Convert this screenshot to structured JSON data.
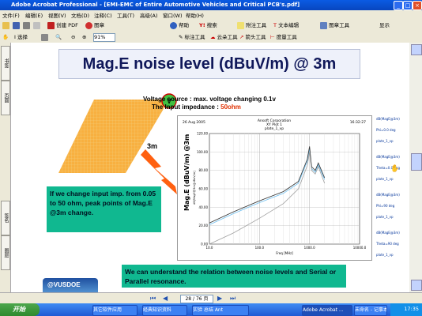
{
  "window": {
    "title": "Adobe Acrobat Professional - [EMI-EMC of Entire Automotive Vehicles and Critical PCB's.pdf]"
  },
  "menu": [
    "文件(F)",
    "编辑(E)",
    "视图(V)",
    "文档(D)",
    "注释(C)",
    "工具(T)",
    "高级(A)",
    "窗口(W)",
    "帮助(H)"
  ],
  "toolbar1": {
    "create_pdf": "创建 PDF",
    "help": "帮助",
    "search": "搜索",
    "attach": "附注工具",
    "text_edit": "文本编辑",
    "stamp": "图章工具",
    "show": "显示"
  },
  "toolbar2": {
    "select": "选择",
    "zoom": "91%",
    "mark": "标注工具",
    "cloud": "云朵工具",
    "arrow": "箭头工具",
    "measure": "度量工具"
  },
  "leftnav": {
    "bookmarks": "书签",
    "pages": "页面",
    "signatures": "签名",
    "layers": "图层"
  },
  "slide": {
    "title": "Mag.E noise level (dBuV/m) @ 3m",
    "voltage_line1": "Voltage source : max. voltage changing 0.1v",
    "voltage_line2_prefix": "The Input impedance : ",
    "voltage_line2_value": "50ohm",
    "v_label": "V",
    "distance": "3m",
    "left_box": "If we change input imp. from 0.05 to 50 ohm, peak points of Mag.E @3m change.",
    "bottom_box": "We can understand the relation between noise levels and Serial or Parallel resonance.",
    "logo_text": "@VUSDOE"
  },
  "plot": {
    "date": "26 Aug 2005",
    "company": "Ansoft Corporation",
    "name": "XY Plot 1",
    "sub": "plate_1_vp",
    "time": "16:32:27",
    "ylabel": "Mag.E (dBuV/m) @3m",
    "ylabel_small": "dB(MagE@3m)[dBuV/m]",
    "xlabel": "Freq [MHz]"
  },
  "chart_data": {
    "type": "line",
    "x_scale": "log",
    "xlim": [
      10,
      10000
    ],
    "ylim": [
      0,
      120
    ],
    "xticks": [
      "10.0",
      "100.0",
      "1000.0",
      "10000.0"
    ],
    "yticks": [
      "0.00",
      "20.00",
      "40.00",
      "60.00",
      "80.00",
      "100.00",
      "120.00"
    ],
    "series": [
      {
        "x": [
          10,
          30,
          100,
          300,
          600,
          900,
          1000,
          1100,
          1300,
          1500,
          2000
        ],
        "y": [
          21,
          33,
          45,
          55,
          66,
          90,
          103,
          82,
          78,
          86,
          70
        ],
        "color": "#70c0f0"
      },
      {
        "x": [
          10,
          30,
          100,
          300,
          600,
          900,
          1000,
          1100,
          1300,
          1500,
          2000
        ],
        "y": [
          23,
          35,
          47,
          57,
          68,
          92,
          106,
          84,
          80,
          88,
          72
        ],
        "color": "#303030"
      },
      {
        "x": [
          10,
          30,
          100,
          300,
          600,
          900,
          1000,
          1100,
          1300,
          1500,
          2000
        ],
        "y": [
          0,
          12,
          28,
          44,
          60,
          85,
          100,
          80,
          76,
          84,
          66
        ],
        "color": "#a0a0a0"
      }
    ]
  },
  "rightlist": [
    "dB(MagE@3m)",
    "Phi=0.0 deg",
    "plate_1_vp",
    "dB(MagE@3m)",
    "Theta=0.0 deg",
    "plate_1_vp",
    "dB(MagE@3m)",
    "Phi=90 deg",
    "plate_1_vp",
    "dB(MagE@3m)",
    "Theta=90 deg",
    "plate_1_vp"
  ],
  "status": {
    "page": "28 / 76 页"
  },
  "taskbar": {
    "start": "开始",
    "tasks": [
      "其它软件应用",
      "经典知识资料",
      "实验 总结 Ant",
      "Adobe Acrobat ...",
      "未命名 - 记事本"
    ],
    "clock": "17:35"
  }
}
